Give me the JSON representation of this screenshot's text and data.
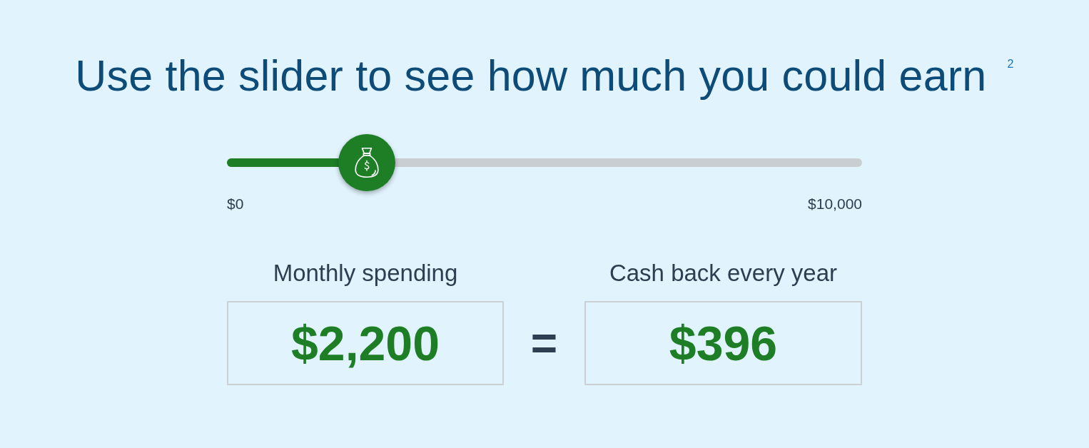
{
  "heading": "Use the slider to see how much you could earn $^{2}$",
  "slider": {
    "level": 0.22,
    "min_label": "$0",
    "max_label": "$10,000"
  },
  "results": [
    {
      "label": "Monthly spending",
      "value": "$2,200"
    },
    {
      "label": "Cash back every year",
      "value": "$396"
    }
  ],
  "operator": "="
}
